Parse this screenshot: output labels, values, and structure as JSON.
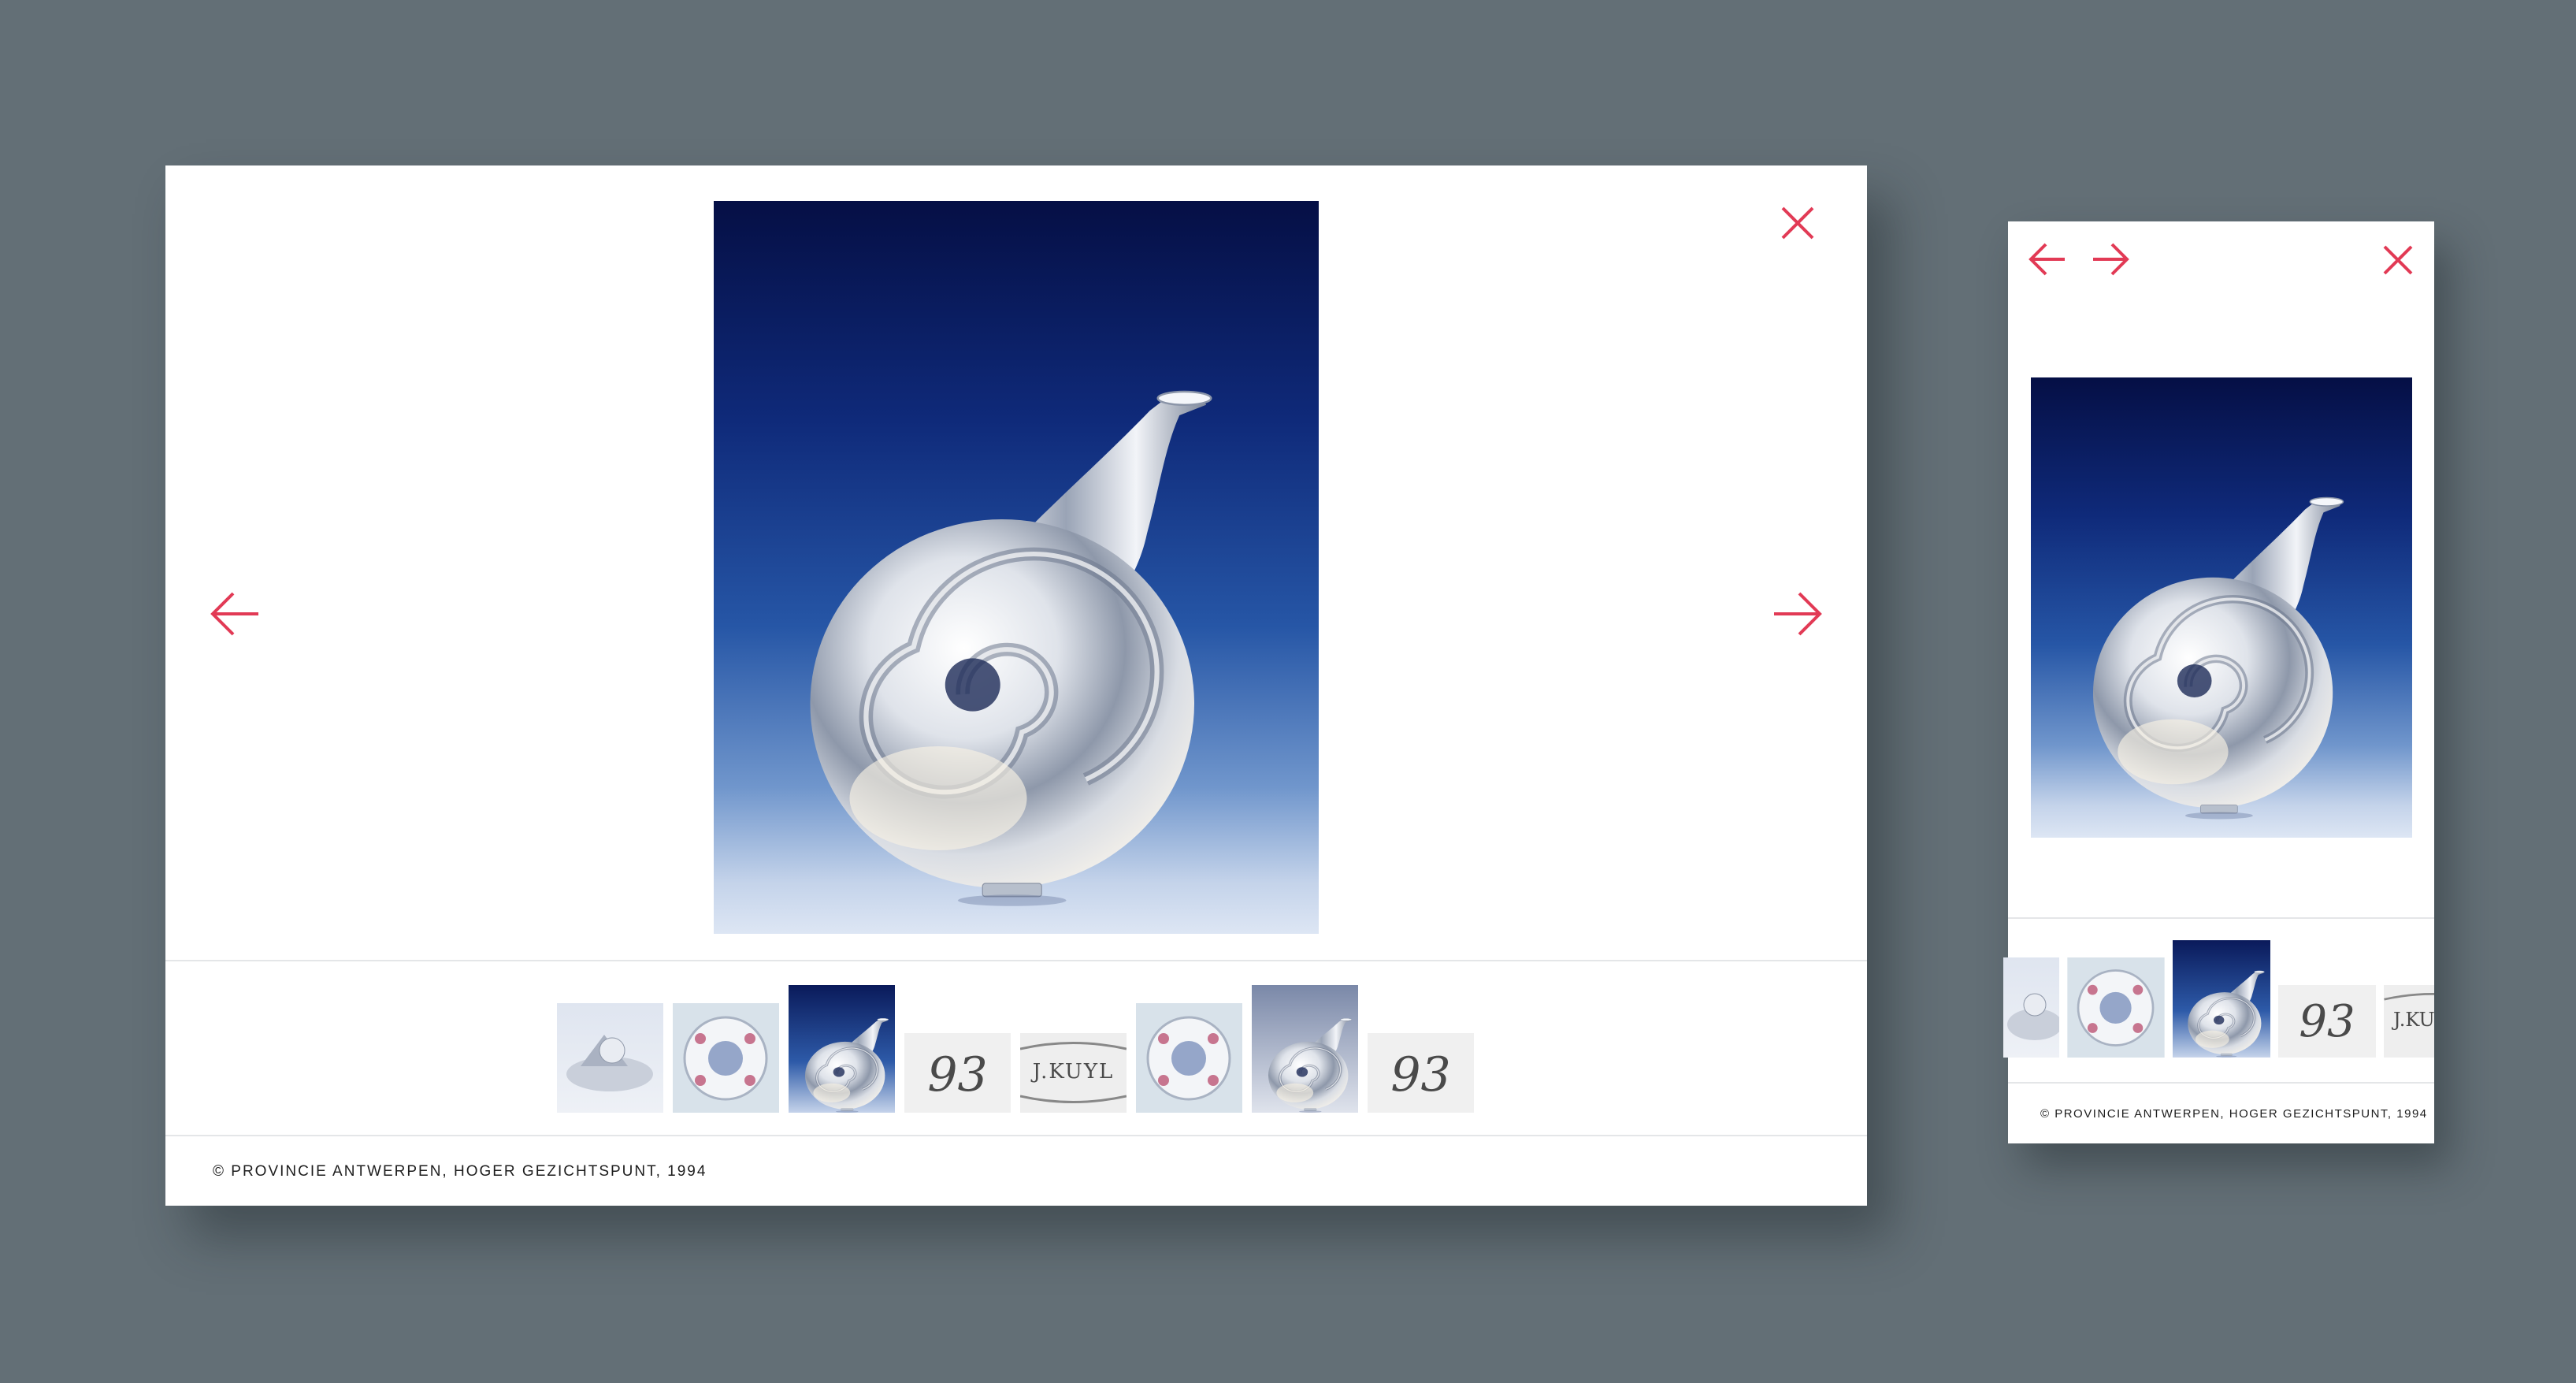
{
  "caption": "© PROVINCIE ANTWERPEN, HOGER GEZICHTSPUNT, 1994",
  "icons": {
    "close": "close-icon",
    "prev": "arrow-left-icon",
    "next": "arrow-right-icon"
  },
  "accent_color": "#e23a55",
  "thumbnails": [
    {
      "kind": "photo-silver"
    },
    {
      "kind": "photo-plate"
    },
    {
      "kind": "photo-vase-blue",
      "selected": true
    },
    {
      "kind": "hallmark",
      "text": "93"
    },
    {
      "kind": "hallmark",
      "text": "J.KUYL"
    },
    {
      "kind": "photo-plate"
    },
    {
      "kind": "photo-vase-grey"
    },
    {
      "kind": "hallmark",
      "text": "93"
    }
  ],
  "mobile_thumbnails": [
    {
      "kind": "photo-silver"
    },
    {
      "kind": "photo-plate"
    },
    {
      "kind": "photo-vase-blue",
      "selected": true
    },
    {
      "kind": "hallmark",
      "text": "93"
    },
    {
      "kind": "hallmark",
      "text": "J.K"
    }
  ]
}
